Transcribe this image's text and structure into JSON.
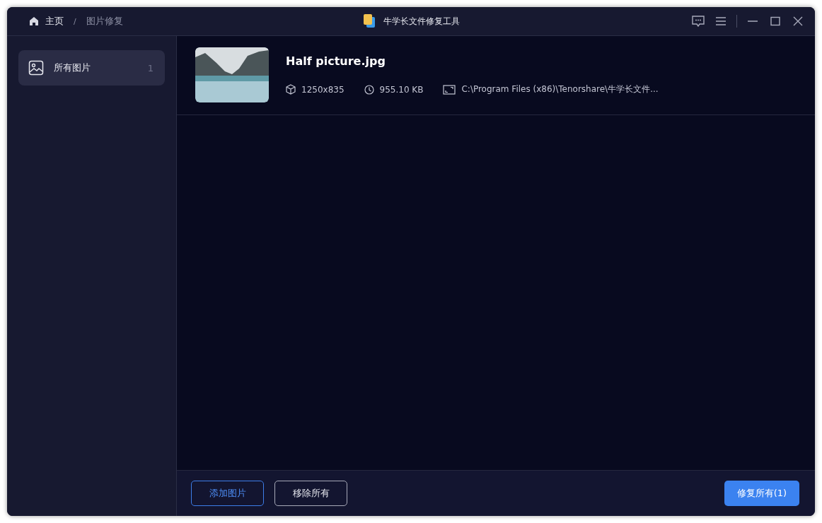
{
  "breadcrumb": {
    "home": "主页",
    "separator": "/",
    "current": "图片修复"
  },
  "window": {
    "title": "牛学长文件修复工具"
  },
  "sidebar": {
    "items": [
      {
        "label": "所有图片",
        "count": "1",
        "selected": true
      }
    ]
  },
  "files": [
    {
      "name": "Half picture.jpg",
      "dimensions": "1250x835",
      "size": "955.10 KB",
      "path": "C:\\Program Files (x86)\\Tenorshare\\牛学长文件..."
    }
  ],
  "footer": {
    "add_button": "添加图片",
    "remove_button": "移除所有",
    "repair_button": "修复所有(1)"
  }
}
